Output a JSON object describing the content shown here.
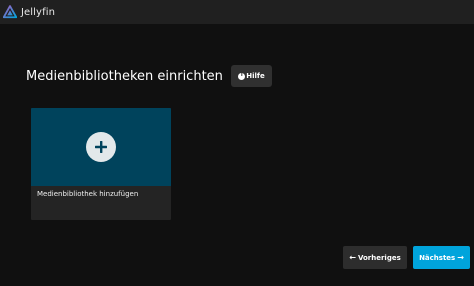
{
  "header": {
    "app_name": "Jellyfin",
    "logo_icon": "jellyfin-logo-icon"
  },
  "main": {
    "title": "Medienbibliotheken einrichten",
    "help_button": {
      "label": "Hilfe",
      "icon": "info-icon"
    },
    "add_card": {
      "label": "Medienbibliothek hinzufügen",
      "icon": "plus-icon"
    }
  },
  "footer": {
    "prev_label": "Vorheriges",
    "next_label": "Nächstes"
  },
  "colors": {
    "background": "#101010",
    "topbar": "#202020",
    "card_image": "#00435c",
    "accent": "#00a4dc",
    "button_dark": "#2d2d2d"
  }
}
